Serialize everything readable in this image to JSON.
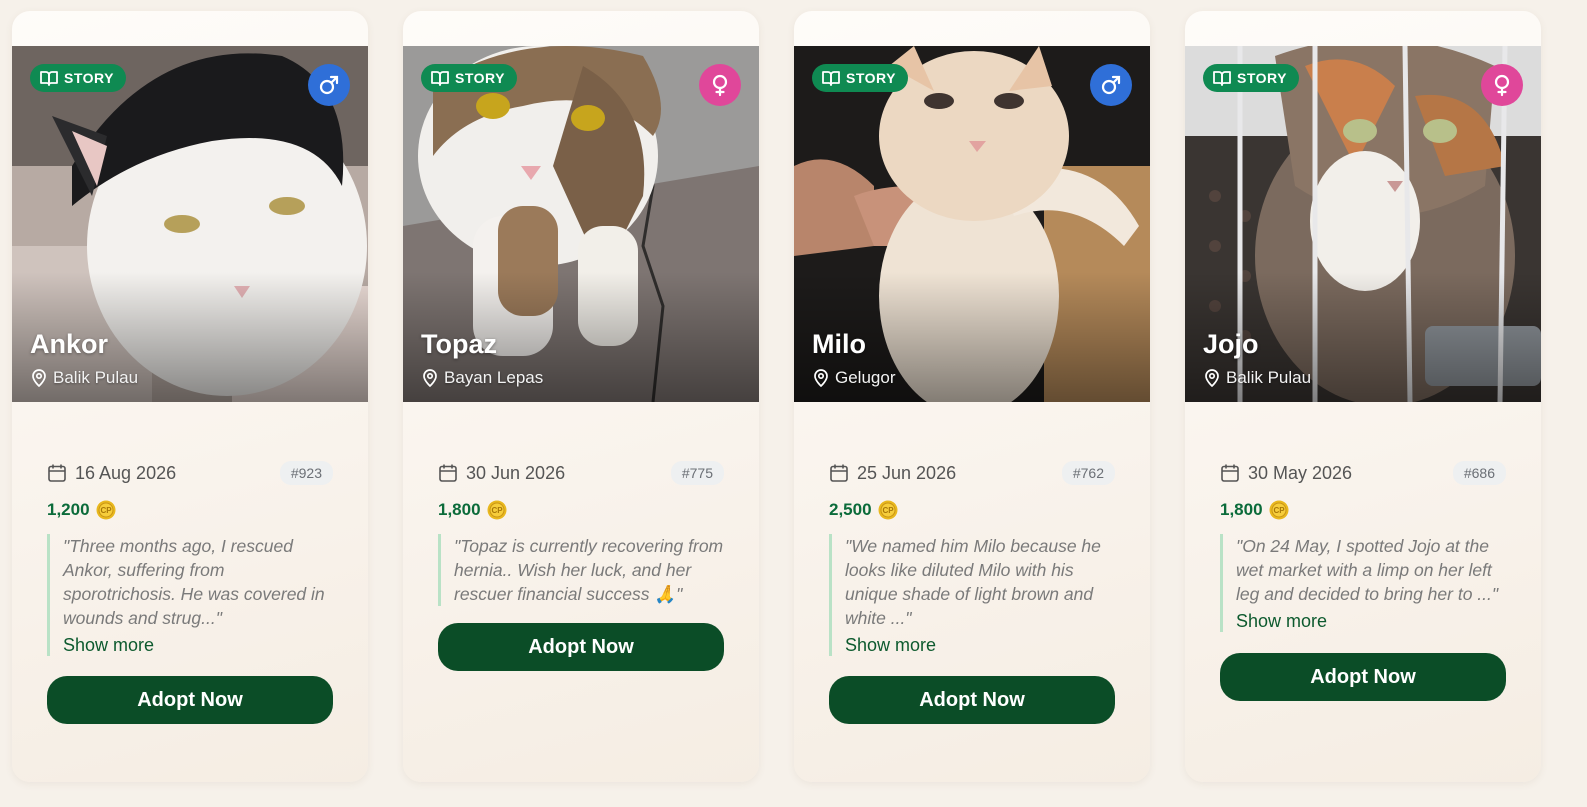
{
  "common": {
    "story_label": "STORY",
    "show_more_label": "Show more",
    "adopt_label": "Adopt Now"
  },
  "cards": [
    {
      "name": "Ankor",
      "gender": "male",
      "location": "Balik Pulau",
      "date": "16 Aug 2026",
      "id": "#923",
      "price": "1,200",
      "quote": "\"Three months ago, I rescued Ankor, suffering from sporotrichosis. He was covered in wounds and strug...\"",
      "has_show_more": true
    },
    {
      "name": "Topaz",
      "gender": "female",
      "location": "Bayan Lepas",
      "date": "30 Jun 2026",
      "id": "#775",
      "price": "1,800",
      "quote": "\"Topaz is currently recovering from hernia.. Wish her luck, and her rescuer financial success 🙏\"",
      "has_show_more": false
    },
    {
      "name": "Milo",
      "gender": "male",
      "location": "Gelugor",
      "date": "25 Jun 2026",
      "id": "#762",
      "price": "2,500",
      "quote": "\"We named him Milo because he looks like diluted Milo with his unique shade of light brown and white ...\"",
      "has_show_more": true
    },
    {
      "name": "Jojo",
      "gender": "female",
      "location": "Balik Pulau",
      "date": "30 May 2026",
      "id": "#686",
      "price": "1,800",
      "quote": "\"On 24 May, I spotted Jojo at the wet market with a limp on her left leg and decided to bring her to ...\"",
      "has_show_more": true
    }
  ],
  "colors": {
    "story_badge": "#0f8a52",
    "male": "#2f6fd8",
    "female": "#e0479a",
    "price": "#0b6b3a",
    "adopt_button": "#0b4d27",
    "quote_border": "#b9e2c6"
  }
}
